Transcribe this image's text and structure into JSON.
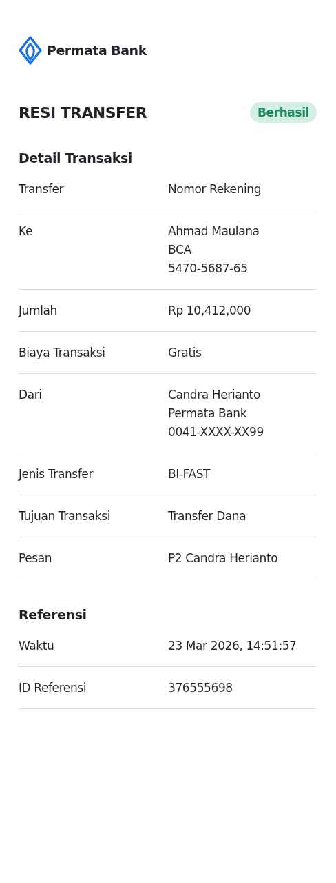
{
  "brand": {
    "name": "Permata Bank"
  },
  "header": {
    "title": "RESI TRANSFER",
    "status": "Berhasil"
  },
  "sections": [
    {
      "title": "Detail Transaksi",
      "rows": [
        {
          "label": "Transfer",
          "values": [
            "Nomor Rekening"
          ]
        },
        {
          "label": "Ke",
          "values": [
            "Ahmad Maulana",
            "BCA",
            "5470-5687-65"
          ]
        },
        {
          "label": "Jumlah",
          "values": [
            "Rp 10,412,000"
          ]
        },
        {
          "label": "Biaya Transaksi",
          "values": [
            "Gratis"
          ]
        },
        {
          "label": "Dari",
          "values": [
            "Candra Herianto",
            "Permata Bank",
            "0041-XXXX-XX99"
          ]
        },
        {
          "label": "Jenis Transfer",
          "values": [
            "BI-FAST"
          ]
        },
        {
          "label": "Tujuan Transaksi",
          "values": [
            "Transfer Dana"
          ]
        },
        {
          "label": "Pesan",
          "values": [
            "P2 Candra Herianto"
          ]
        }
      ]
    },
    {
      "title": "Referensi",
      "rows": [
        {
          "label": "Waktu",
          "values": [
            "23 Mar 2026, 14:51:57"
          ]
        },
        {
          "label": "ID Referensi",
          "values": [
            "376555698"
          ]
        }
      ]
    }
  ]
}
